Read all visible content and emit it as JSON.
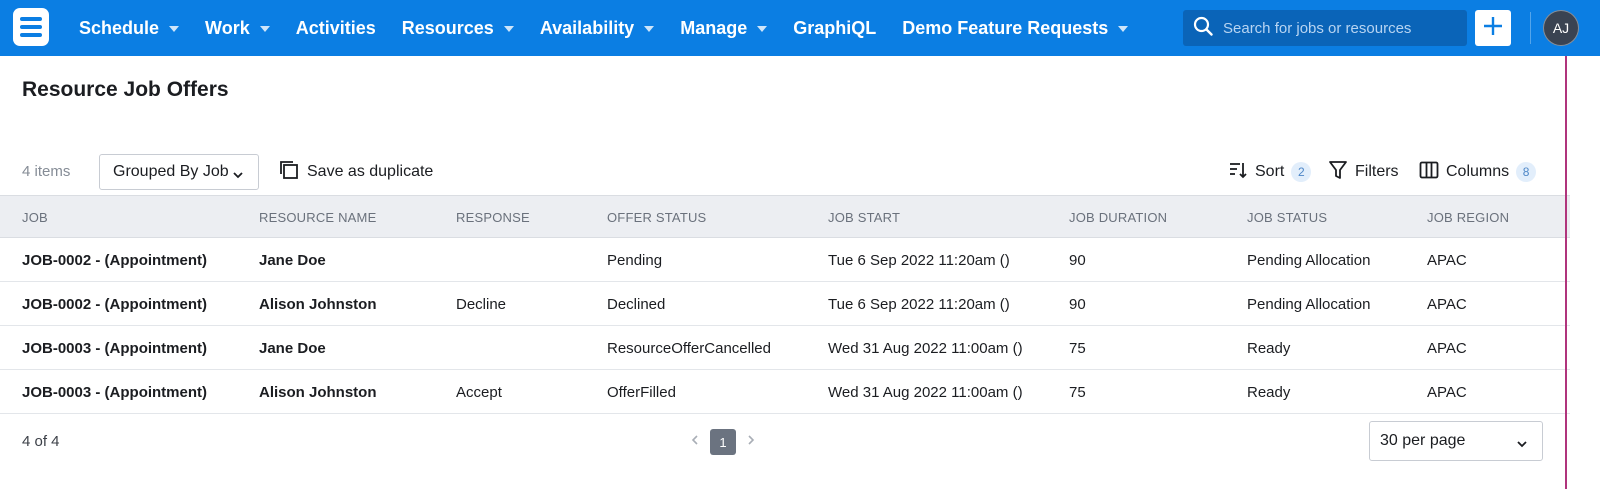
{
  "nav": {
    "menu": [
      {
        "label": "Schedule",
        "dropdown": true
      },
      {
        "label": "Work",
        "dropdown": true
      },
      {
        "label": "Activities",
        "dropdown": false
      },
      {
        "label": "Resources",
        "dropdown": true
      },
      {
        "label": "Availability",
        "dropdown": true
      },
      {
        "label": "Manage",
        "dropdown": true
      },
      {
        "label": "GraphiQL",
        "dropdown": false
      },
      {
        "label": "Demo Feature Requests",
        "dropdown": true
      }
    ],
    "search_placeholder": "Search for jobs or resources",
    "avatar_initials": "AJ",
    "colors": {
      "bar": "#0b7ee3",
      "search": "#0a64b8"
    }
  },
  "page": {
    "title": "Resource Job Offers"
  },
  "toolbar": {
    "item_count": "4 items",
    "group_by": "Grouped By Job",
    "save_duplicate": "Save as duplicate",
    "sort_label": "Sort",
    "sort_count": "2",
    "filters_label": "Filters",
    "columns_label": "Columns",
    "columns_count": "8"
  },
  "table": {
    "columns": [
      "JOB",
      "RESOURCE NAME",
      "RESPONSE",
      "OFFER STATUS",
      "JOB START",
      "JOB DURATION",
      "JOB STATUS",
      "JOB REGION"
    ],
    "rows": [
      [
        "JOB-0002 - (Appointment)",
        "Jane Doe",
        "",
        "Pending",
        "Tue 6 Sep 2022 11:20am ()",
        "90",
        "Pending Allocation",
        "APAC"
      ],
      [
        "JOB-0002 - (Appointment)",
        "Alison Johnston",
        "Decline",
        "Declined",
        "Tue 6 Sep 2022 11:20am ()",
        "90",
        "Pending Allocation",
        "APAC"
      ],
      [
        "JOB-0003 - (Appointment)",
        "Jane Doe",
        "",
        "ResourceOfferCancelled",
        "Wed 31 Aug 2022 11:00am ()",
        "75",
        "Ready",
        "APAC"
      ],
      [
        "JOB-0003 - (Appointment)",
        "Alison Johnston",
        "Accept",
        "OfferFilled",
        "Wed 31 Aug 2022 11:00am ()",
        "75",
        "Ready",
        "APAC"
      ]
    ]
  },
  "footer": {
    "count": "4 of 4",
    "current_page": "1",
    "per_page": "30 per page"
  }
}
